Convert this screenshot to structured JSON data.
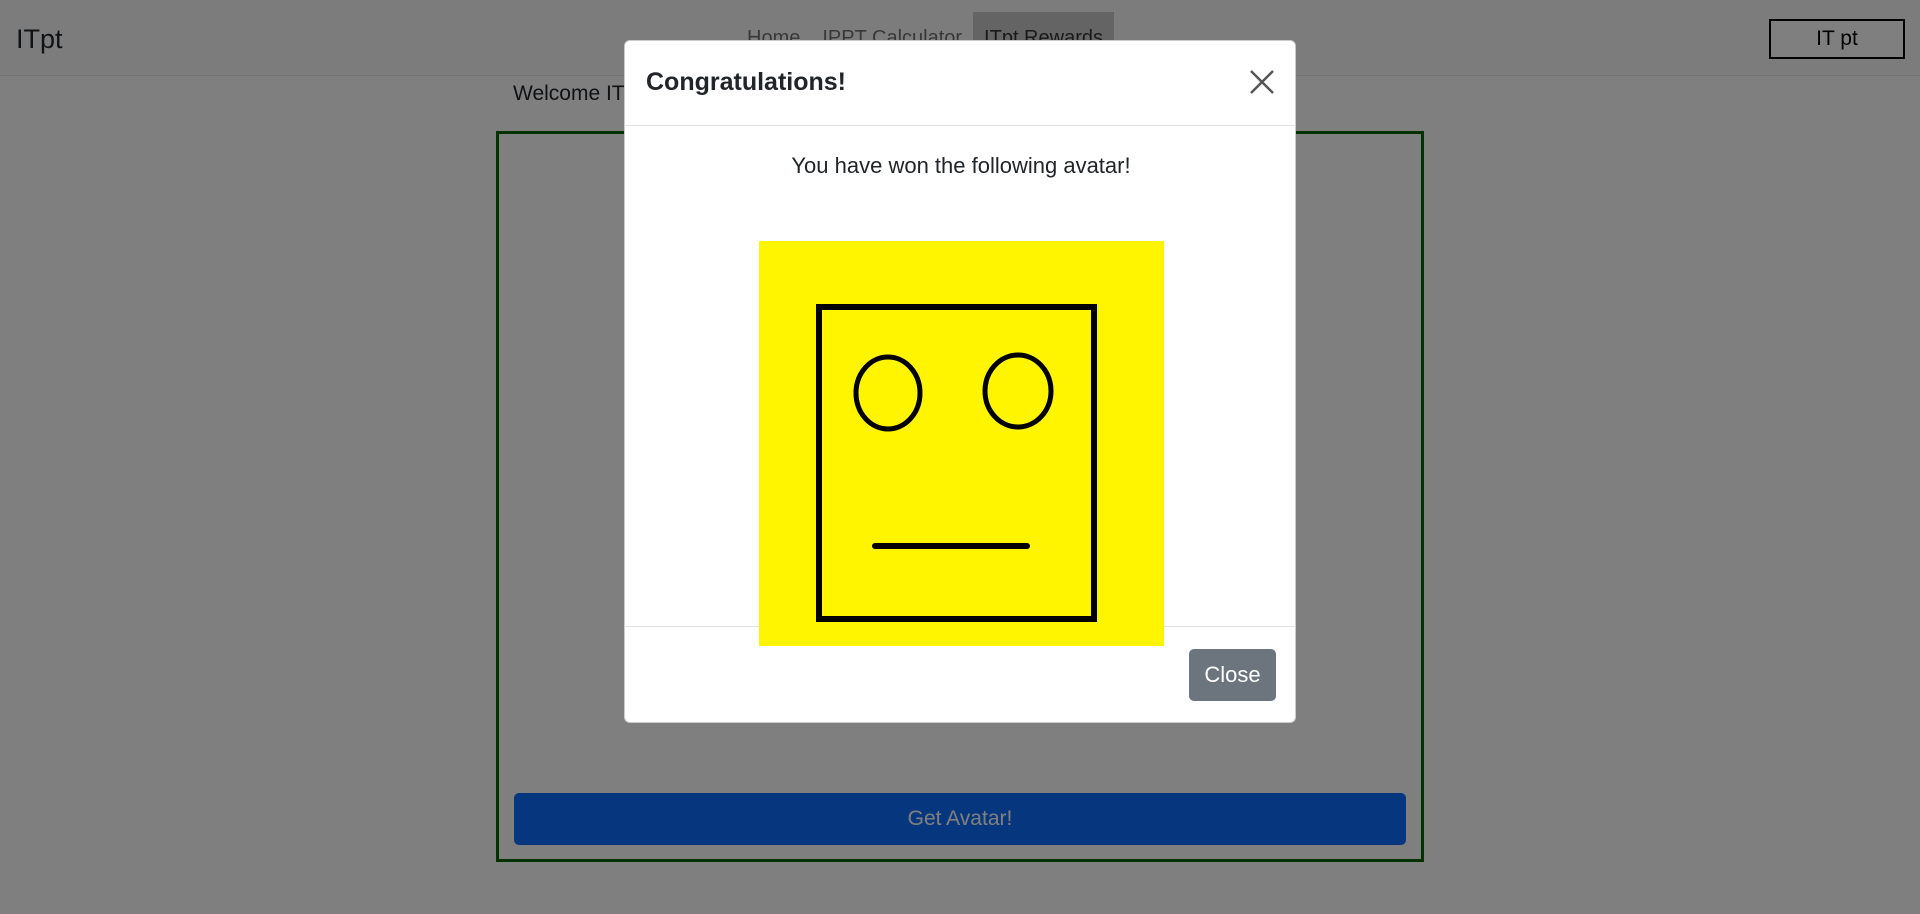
{
  "navbar": {
    "brand": "ITpt",
    "links": [
      {
        "label": "Home"
      },
      {
        "label": "IPPT Calculator"
      },
      {
        "label": "ITpt Rewards"
      }
    ],
    "points_label": "IT pt"
  },
  "main": {
    "welcome_text": "Welcome IT",
    "get_avatar_label": "Get Avatar!"
  },
  "modal": {
    "title": "Congratulations!",
    "close_icon": "close-icon",
    "message": "You have won the following avatar!",
    "avatar": {
      "background_color": "#fff500",
      "stroke_color": "#000000",
      "expression": "neutral"
    },
    "close_button_label": "Close"
  },
  "colors": {
    "primary": "#0d6efd",
    "secondary": "#6c757d",
    "box_border": "#006400"
  }
}
